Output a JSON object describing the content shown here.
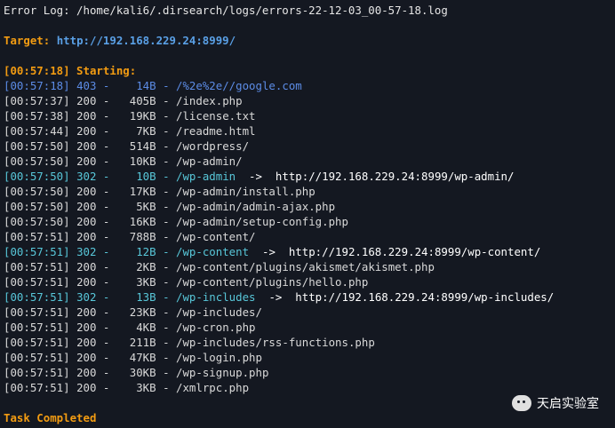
{
  "header": {
    "error_log": "Error Log: /home/kali6/.dirsearch/logs/errors-22-12-03_00-57-18.log",
    "target_label": "Target: ",
    "target_url": "http://192.168.229.24:8999/"
  },
  "starting": "[00:57:18] Starting:",
  "results": [
    {
      "time": "[00:57:18]",
      "code": "403",
      "size": "14B",
      "path": "/%2e%2e//google.com",
      "redirect": ""
    },
    {
      "time": "[00:57:37]",
      "code": "200",
      "size": "405B",
      "path": "/index.php",
      "redirect": ""
    },
    {
      "time": "[00:57:38]",
      "code": "200",
      "size": "19KB",
      "path": "/license.txt",
      "redirect": ""
    },
    {
      "time": "[00:57:44]",
      "code": "200",
      "size": "7KB",
      "path": "/readme.html",
      "redirect": ""
    },
    {
      "time": "[00:57:50]",
      "code": "200",
      "size": "514B",
      "path": "/wordpress/",
      "redirect": ""
    },
    {
      "time": "[00:57:50]",
      "code": "200",
      "size": "10KB",
      "path": "/wp-admin/",
      "redirect": ""
    },
    {
      "time": "[00:57:50]",
      "code": "302",
      "size": "10B",
      "path": "/wp-admin",
      "redirect": "http://192.168.229.24:8999/wp-admin/"
    },
    {
      "time": "[00:57:50]",
      "code": "200",
      "size": "17KB",
      "path": "/wp-admin/install.php",
      "redirect": ""
    },
    {
      "time": "[00:57:50]",
      "code": "200",
      "size": "5KB",
      "path": "/wp-admin/admin-ajax.php",
      "redirect": ""
    },
    {
      "time": "[00:57:50]",
      "code": "200",
      "size": "16KB",
      "path": "/wp-admin/setup-config.php",
      "redirect": ""
    },
    {
      "time": "[00:57:51]",
      "code": "200",
      "size": "788B",
      "path": "/wp-content/",
      "redirect": ""
    },
    {
      "time": "[00:57:51]",
      "code": "302",
      "size": "12B",
      "path": "/wp-content",
      "redirect": "http://192.168.229.24:8999/wp-content/"
    },
    {
      "time": "[00:57:51]",
      "code": "200",
      "size": "2KB",
      "path": "/wp-content/plugins/akismet/akismet.php",
      "redirect": ""
    },
    {
      "time": "[00:57:51]",
      "code": "200",
      "size": "3KB",
      "path": "/wp-content/plugins/hello.php",
      "redirect": ""
    },
    {
      "time": "[00:57:51]",
      "code": "302",
      "size": "13B",
      "path": "/wp-includes",
      "redirect": "http://192.168.229.24:8999/wp-includes/"
    },
    {
      "time": "[00:57:51]",
      "code": "200",
      "size": "23KB",
      "path": "/wp-includes/",
      "redirect": ""
    },
    {
      "time": "[00:57:51]",
      "code": "200",
      "size": "4KB",
      "path": "/wp-cron.php",
      "redirect": ""
    },
    {
      "time": "[00:57:51]",
      "code": "200",
      "size": "211B",
      "path": "/wp-includes/rss-functions.php",
      "redirect": ""
    },
    {
      "time": "[00:57:51]",
      "code": "200",
      "size": "47KB",
      "path": "/wp-login.php",
      "redirect": ""
    },
    {
      "time": "[00:57:51]",
      "code": "200",
      "size": "30KB",
      "path": "/wp-signup.php",
      "redirect": ""
    },
    {
      "time": "[00:57:51]",
      "code": "200",
      "size": "3KB",
      "path": "/xmlrpc.php",
      "redirect": ""
    }
  ],
  "completed": "Task Completed",
  "watermark": {
    "icon": "wechat-icon",
    "text": "天启实验室"
  },
  "colors": {
    "background": "#141821",
    "orange": "#f39c12",
    "blue": "#5c8ce6",
    "cyan": "#58c7d9",
    "status_ok": "#5fbf4a"
  }
}
